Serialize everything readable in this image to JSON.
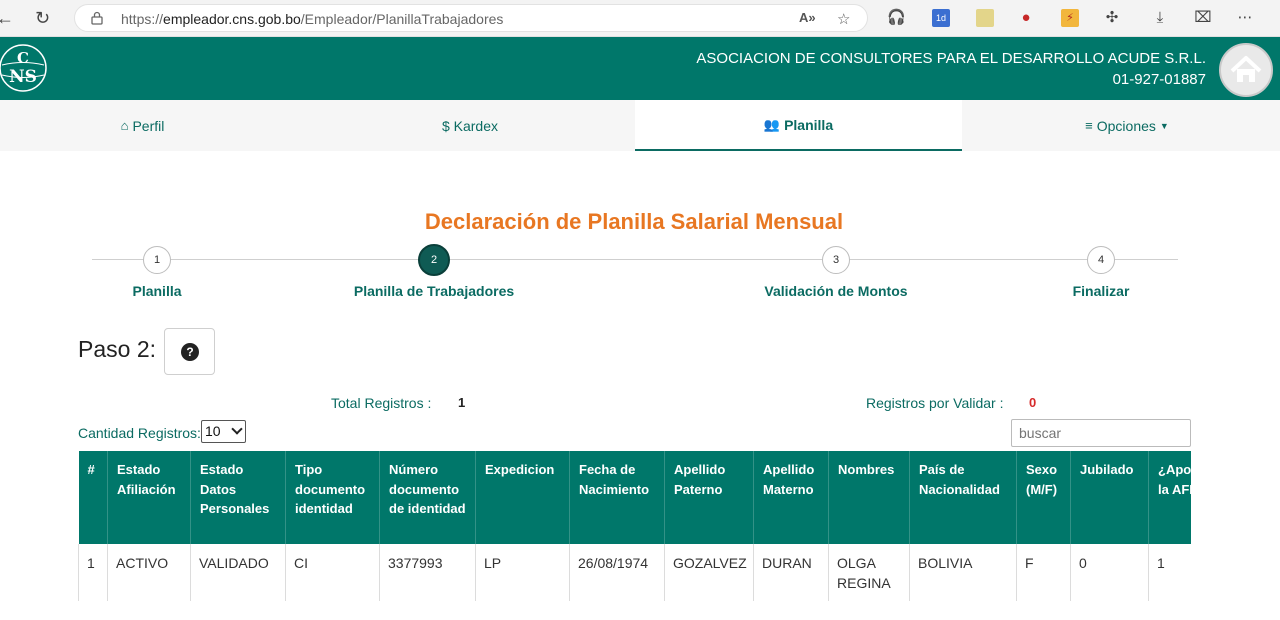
{
  "browser": {
    "url_scheme": "https://",
    "url_host": "empleador.cns.gob.bo",
    "url_path": "/Empleador/PlanillaTrabajadores"
  },
  "header": {
    "logo_text": "CNS",
    "company_name": "ASOCIACION DE CONSULTORES PARA EL DESARROLLO ACUDE S.R.L.",
    "employer_number": "01-927-01887"
  },
  "tabs": [
    {
      "label": "Perfil",
      "icon": "home-icon"
    },
    {
      "label": "$ Kardex",
      "icon": ""
    },
    {
      "label": "Planilla",
      "icon": "users-icon"
    },
    {
      "label": "Opciones",
      "icon": "menu-icon"
    }
  ],
  "title": "Declaración de Planilla Salarial Mensual",
  "stepper": {
    "active_step": 2,
    "steps": [
      {
        "number": "1",
        "label": "Planilla"
      },
      {
        "number": "2",
        "label": "Planilla de Trabajadores"
      },
      {
        "number": "3",
        "label": "Validación de Montos"
      },
      {
        "number": "4",
        "label": "Finalizar"
      }
    ]
  },
  "paso_label": "Paso 2:",
  "stats": {
    "total_label": "Total Registros :",
    "total_value": "1",
    "pending_label": "Registros por Validar :",
    "pending_value": "0"
  },
  "cantidad_label": "Cantidad Registros:",
  "cantidad_value": "10",
  "search_placeholder": "buscar",
  "table": {
    "columns": [
      "#",
      "Estado Afiliación",
      "Estado Datos Personales",
      "Tipo documento identidad",
      "Número documento de identidad",
      "Expedicion",
      "Fecha de Nacimiento",
      "Apellido Paterno",
      "Apellido Materno",
      "Nombres",
      "País de Nacionalidad",
      "Sexo (M/F)",
      "Jubilado",
      "¿Aporta a la AFP?"
    ],
    "rows": [
      [
        "1",
        "ACTIVO",
        "VALIDADO",
        "CI",
        "3377993",
        "LP",
        "26/08/1974",
        "GOZALVEZ",
        "DURAN",
        "OLGA REGINA",
        "BOLIVIA",
        "F",
        "0",
        "1"
      ]
    ]
  },
  "colors": {
    "header_green": "#00776a",
    "accent_orange": "#e87722",
    "step_active": "#0f5b54",
    "pending_red": "#d62b2b"
  }
}
